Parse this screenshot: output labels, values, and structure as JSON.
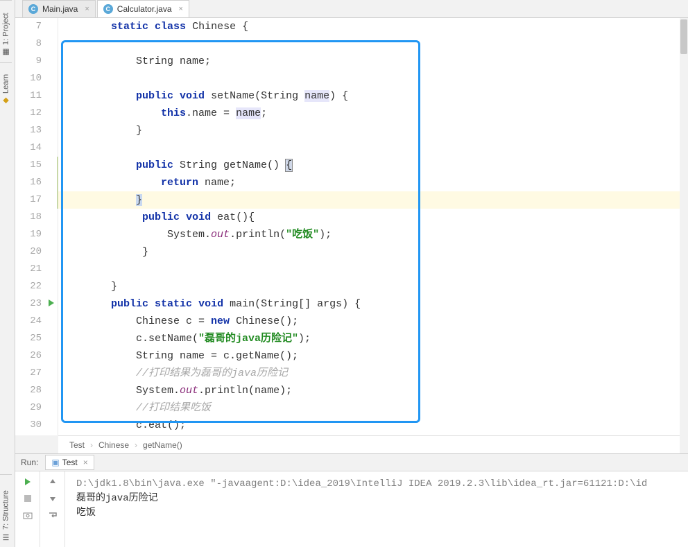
{
  "rail": {
    "project": "1: Project",
    "learn": "Learn",
    "structure": "7: Structure"
  },
  "tabs": [
    {
      "label": "Main.java",
      "active": false
    },
    {
      "label": "Calculator.java",
      "active": true
    }
  ],
  "lines": {
    "start": 7,
    "end": 30
  },
  "code": {
    "l7": {
      "indent": 1,
      "tokens": [
        [
          "kw",
          "static"
        ],
        [
          "",
          " "
        ],
        [
          "kw",
          "class"
        ],
        [
          "",
          " Chinese {"
        ]
      ]
    },
    "l8": {
      "indent": 1,
      "tokens": []
    },
    "l9": {
      "indent": 2,
      "tokens": [
        [
          "",
          "String "
        ],
        [
          "",
          "name;"
        ]
      ]
    },
    "l10": {
      "indent": 1,
      "tokens": []
    },
    "l11": {
      "indent": 2,
      "tokens": [
        [
          "kw",
          "public"
        ],
        [
          "",
          " "
        ],
        [
          "kw",
          "void"
        ],
        [
          "",
          " setName(String "
        ],
        [
          "paramhl",
          "name"
        ],
        [
          "",
          ") {"
        ]
      ]
    },
    "l12": {
      "indent": 3,
      "tokens": [
        [
          "kw",
          "this"
        ],
        [
          "",
          ".name = "
        ],
        [
          "paramhl",
          "name"
        ],
        [
          "",
          ";"
        ]
      ]
    },
    "l13": {
      "indent": 2,
      "tokens": [
        [
          "",
          "}"
        ]
      ]
    },
    "l14": {
      "indent": 1,
      "tokens": []
    },
    "l15": {
      "indent": 2,
      "tokens": [
        [
          "kw",
          "public"
        ],
        [
          "",
          " String getName() "
        ],
        [
          "brhl",
          "{"
        ]
      ]
    },
    "l16": {
      "indent": 3,
      "tokens": [
        [
          "kw",
          "return"
        ],
        [
          "",
          " name;"
        ]
      ]
    },
    "l17": {
      "indent": 2,
      "tokens": [
        [
          "caretbg",
          "}"
        ]
      ],
      "highlight": true
    },
    "l18": {
      "indent": 2,
      "tokens": [
        [
          "",
          " "
        ],
        [
          "kw",
          "public"
        ],
        [
          "",
          " "
        ],
        [
          "kw",
          "void"
        ],
        [
          "",
          " eat(){"
        ]
      ]
    },
    "l19": {
      "indent": 3,
      "tokens": [
        [
          "",
          " System."
        ],
        [
          "fld",
          "out"
        ],
        [
          "",
          ".println("
        ],
        [
          "str",
          "\"吃饭\""
        ],
        [
          "",
          ");"
        ]
      ]
    },
    "l20": {
      "indent": 2,
      "tokens": [
        [
          "",
          " }"
        ]
      ]
    },
    "l21": {
      "indent": 1,
      "tokens": []
    },
    "l22": {
      "indent": 1,
      "tokens": [
        [
          "",
          "}"
        ]
      ]
    },
    "l23": {
      "indent": 1,
      "tokens": [
        [
          "kw",
          "public"
        ],
        [
          "",
          " "
        ],
        [
          "kw",
          "static"
        ],
        [
          "",
          " "
        ],
        [
          "kw",
          "void"
        ],
        [
          "",
          " main(String[] args) {"
        ]
      ]
    },
    "l24": {
      "indent": 2,
      "tokens": [
        [
          "",
          "Chinese c = "
        ],
        [
          "kw",
          "new"
        ],
        [
          "",
          " Chinese();"
        ]
      ]
    },
    "l25": {
      "indent": 2,
      "tokens": [
        [
          "",
          "c.setName("
        ],
        [
          "str",
          "\"磊哥的java历险记\""
        ],
        [
          "",
          ");"
        ]
      ]
    },
    "l26": {
      "indent": 2,
      "tokens": [
        [
          "",
          "String name = c.getName();"
        ]
      ]
    },
    "l27": {
      "indent": 2,
      "tokens": [
        [
          "cmt",
          "//打印结果为磊哥的java历险记"
        ]
      ]
    },
    "l28": {
      "indent": 2,
      "tokens": [
        [
          "",
          "System."
        ],
        [
          "fld",
          "out"
        ],
        [
          "",
          ".println(name);"
        ]
      ]
    },
    "l29": {
      "indent": 2,
      "tokens": [
        [
          "cmt",
          "//打印结果吃饭"
        ]
      ]
    },
    "l30": {
      "indent": 2,
      "tokens": [
        [
          "",
          "c.eat();"
        ]
      ]
    }
  },
  "breadcrumb": [
    "Test",
    "Chinese",
    "getName()"
  ],
  "run": {
    "label": "Run:",
    "config": "Test",
    "lines": [
      "D:\\jdk1.8\\bin\\java.exe \"-javaagent:D:\\idea_2019\\IntelliJ IDEA 2019.2.3\\lib\\idea_rt.jar=61121:D:\\id",
      "磊哥的java历险记",
      "吃饭"
    ]
  }
}
